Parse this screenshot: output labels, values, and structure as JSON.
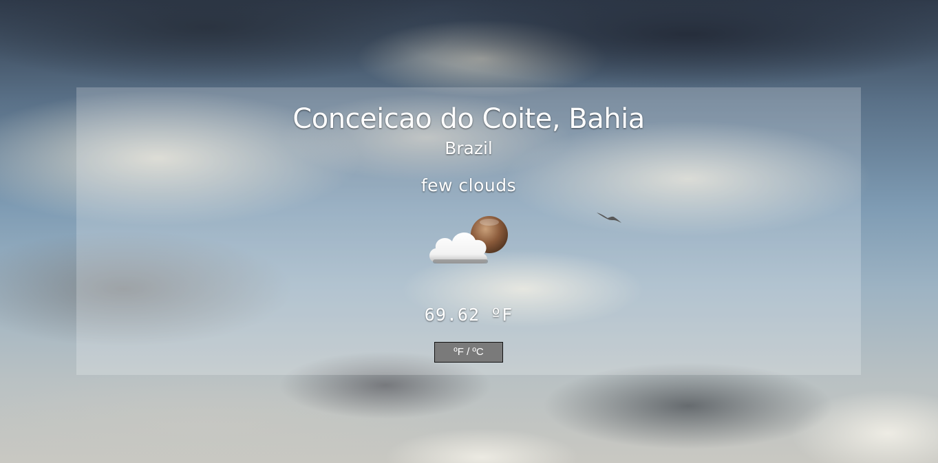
{
  "location": {
    "city_region": "Conceicao do Coite, Bahia",
    "country": "Brazil"
  },
  "weather": {
    "description": "few clouds",
    "icon": "few-clouds-icon",
    "temperature": "69.62 ºF"
  },
  "controls": {
    "unit_toggle_label": "ºF / ºC"
  },
  "colors": {
    "panel_overlay": "#ffffff",
    "button_background": "#7a7a7a",
    "text": "#ffffff"
  }
}
